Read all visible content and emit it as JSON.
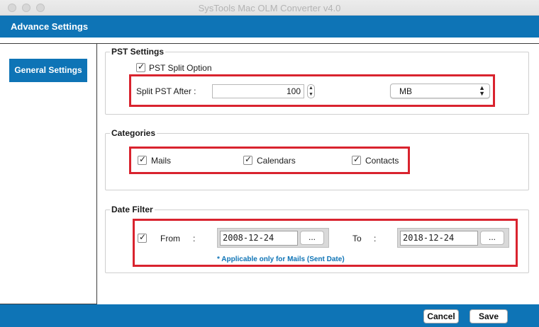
{
  "window": {
    "title": "SysTools Mac OLM Converter v4.0"
  },
  "header": {
    "title": "Advance Settings"
  },
  "sidebar": {
    "items": [
      {
        "label": "General Settings"
      }
    ]
  },
  "pst_settings": {
    "title": "PST Settings",
    "split_option_label": "PST Split Option",
    "split_option_checked": true,
    "split_after_label": "Split PST After :",
    "split_value": "100",
    "unit_selected": "MB"
  },
  "categories": {
    "title": "Categories",
    "items": [
      {
        "label": "Mails",
        "checked": true
      },
      {
        "label": "Calendars",
        "checked": true
      },
      {
        "label": "Contacts",
        "checked": true
      }
    ]
  },
  "date_filter": {
    "title": "Date Filter",
    "enabled": true,
    "from_label": "From",
    "from_colon": ":",
    "from_value": "2008-12-24",
    "to_label": "To",
    "to_colon": ":",
    "to_value": "2018-12-24",
    "browse_label": "...",
    "note": "* Applicable only for Mails (Sent Date)"
  },
  "footer": {
    "cancel_label": "Cancel",
    "save_label": "Save"
  },
  "colors": {
    "accent": "#0e74b6",
    "highlight": "#d9232e"
  },
  "icons": [
    "checkbox-icon",
    "stepper-icon",
    "dropdown-chevron-icon"
  ]
}
